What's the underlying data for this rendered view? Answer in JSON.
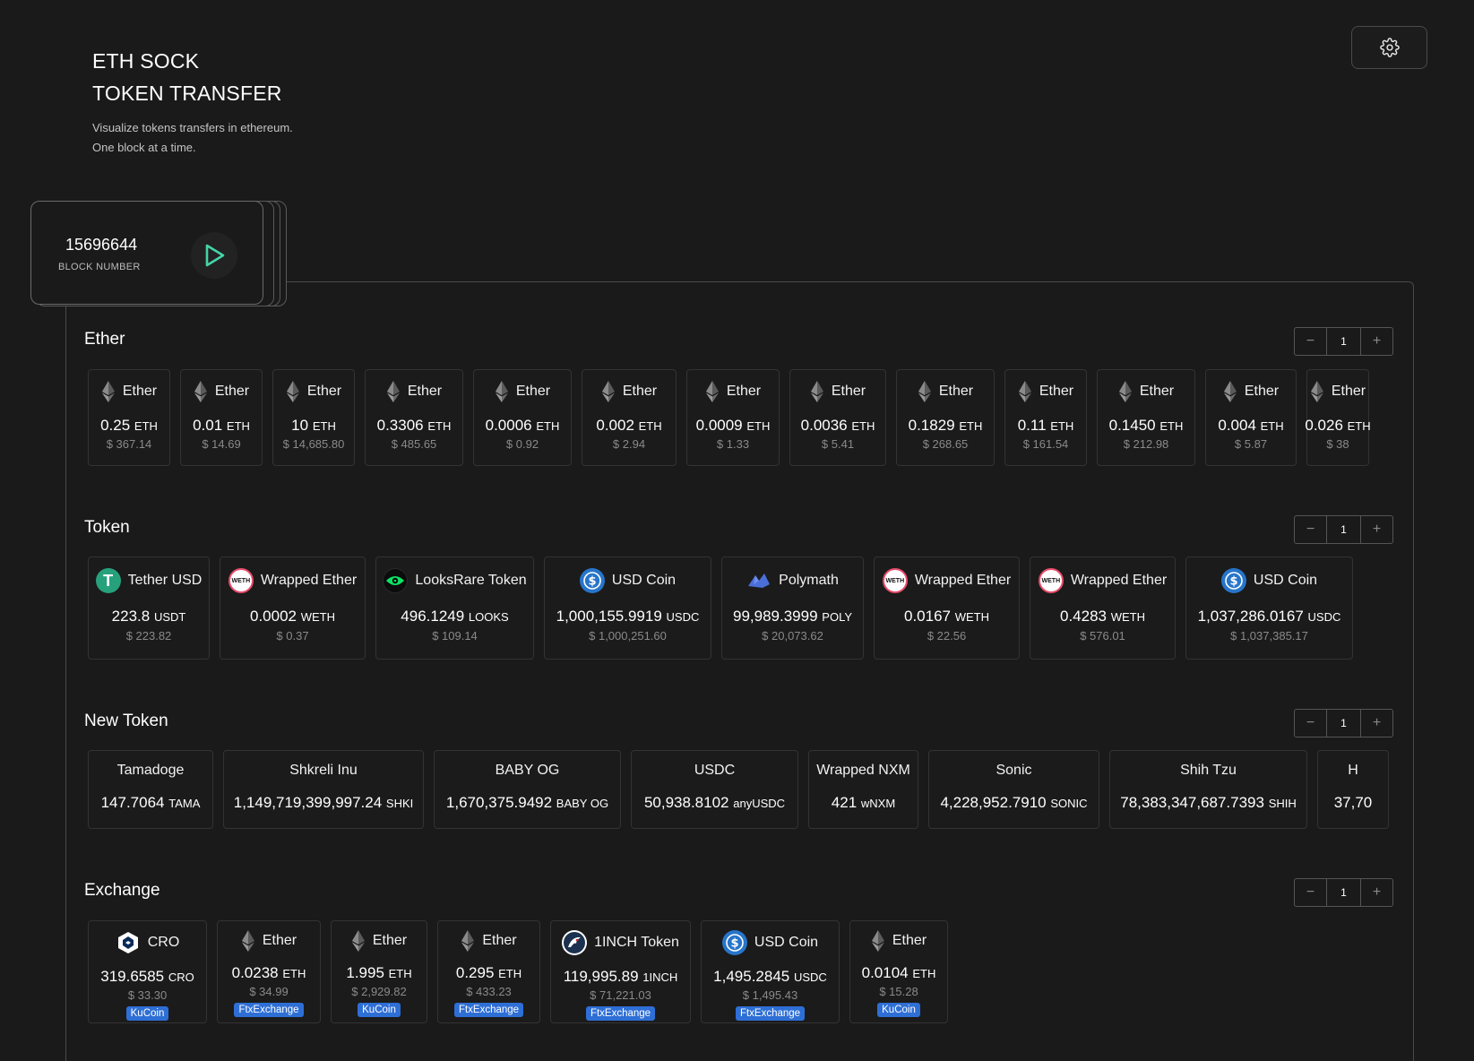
{
  "header": {
    "title_line1": "ETH SOCK",
    "title_line2": "TOKEN TRANSFER",
    "subtitle_line1": "Visualize tokens transfers in ethereum.",
    "subtitle_line2": "One block at a time."
  },
  "block": {
    "number": "15696644",
    "label": "BLOCK NUMBER"
  },
  "colors": {
    "accent": "#46d4a8",
    "badge": "#2e6fd6",
    "background": "#1a1a1a"
  },
  "sections": {
    "ether": {
      "title": "Ether",
      "stepper": {
        "minus": "−",
        "value": "1",
        "plus": "+"
      },
      "cards": [
        {
          "name": "Ether",
          "amount": "0.25",
          "symbol": "ETH",
          "usd": "$ 367.14"
        },
        {
          "name": "Ether",
          "amount": "0.01",
          "symbol": "ETH",
          "usd": "$ 14.69"
        },
        {
          "name": "Ether",
          "amount": "10",
          "symbol": "ETH",
          "usd": "$ 14,685.80"
        },
        {
          "name": "Ether",
          "amount": "0.3306",
          "symbol": "ETH",
          "usd": "$ 485.65"
        },
        {
          "name": "Ether",
          "amount": "0.0006",
          "symbol": "ETH",
          "usd": "$ 0.92"
        },
        {
          "name": "Ether",
          "amount": "0.002",
          "symbol": "ETH",
          "usd": "$ 2.94"
        },
        {
          "name": "Ether",
          "amount": "0.0009",
          "symbol": "ETH",
          "usd": "$ 1.33"
        },
        {
          "name": "Ether",
          "amount": "0.0036",
          "symbol": "ETH",
          "usd": "$ 5.41"
        },
        {
          "name": "Ether",
          "amount": "0.1829",
          "symbol": "ETH",
          "usd": "$ 268.65"
        },
        {
          "name": "Ether",
          "amount": "0.11",
          "symbol": "ETH",
          "usd": "$ 161.54"
        },
        {
          "name": "Ether",
          "amount": "0.1450",
          "symbol": "ETH",
          "usd": "$ 212.98"
        },
        {
          "name": "Ether",
          "amount": "0.004",
          "symbol": "ETH",
          "usd": "$ 5.87"
        },
        {
          "name": "Ether",
          "amount": "0.026",
          "symbol": "ETH",
          "usd": "$ 38"
        }
      ]
    },
    "token": {
      "title": "Token",
      "stepper": {
        "minus": "−",
        "value": "1",
        "plus": "+"
      },
      "cards": [
        {
          "icon": "tether-icon",
          "name": "Tether USD",
          "amount": "223.8",
          "symbol": "USDT",
          "usd": "$ 223.82"
        },
        {
          "icon": "weth-icon",
          "name": "Wrapped Ether",
          "amount": "0.0002",
          "symbol": "WETH",
          "usd": "$ 0.37"
        },
        {
          "icon": "looksrare-icon",
          "name": "LooksRare Token",
          "amount": "496.1249",
          "symbol": "LOOKS",
          "usd": "$ 109.14"
        },
        {
          "icon": "usdc-icon",
          "name": "USD Coin",
          "amount": "1,000,155.9919",
          "symbol": "USDC",
          "usd": "$ 1,000,251.60"
        },
        {
          "icon": "polymath-icon",
          "name": "Polymath",
          "amount": "99,989.3999",
          "symbol": "POLY",
          "usd": "$ 20,073.62"
        },
        {
          "icon": "weth-icon",
          "name": "Wrapped Ether",
          "amount": "0.0167",
          "symbol": "WETH",
          "usd": "$ 22.56"
        },
        {
          "icon": "weth-icon",
          "name": "Wrapped Ether",
          "amount": "0.4283",
          "symbol": "WETH",
          "usd": "$ 576.01"
        },
        {
          "icon": "usdc-icon",
          "name": "USD Coin",
          "amount": "1,037,286.0167",
          "symbol": "USDC",
          "usd": "$ 1,037,385.17"
        }
      ]
    },
    "new_token": {
      "title": "New Token",
      "stepper": {
        "minus": "−",
        "value": "1",
        "plus": "+"
      },
      "cards": [
        {
          "name": "Tamadoge",
          "amount": "147.7064",
          "symbol": "TAMA"
        },
        {
          "name": "Shkreli Inu",
          "amount": "1,149,719,399,997.24",
          "symbol": "SHKI"
        },
        {
          "name": "BABY OG",
          "amount": "1,670,375.9492",
          "symbol": "BABY OG"
        },
        {
          "name": "USDC",
          "amount": "50,938.8102",
          "symbol": "anyUSDC"
        },
        {
          "name": "Wrapped NXM",
          "amount": "421",
          "symbol": "wNXM"
        },
        {
          "name": "Sonic",
          "amount": "4,228,952.7910",
          "symbol": "SONIC"
        },
        {
          "name": "Shih Tzu",
          "amount": "78,383,347,687.7393",
          "symbol": "SHIH"
        },
        {
          "name": "H",
          "amount": "37,70",
          "symbol": ""
        }
      ]
    },
    "exchange": {
      "title": "Exchange",
      "stepper": {
        "minus": "−",
        "value": "1",
        "plus": "+"
      },
      "cards": [
        {
          "icon": "cro-icon",
          "name": "CRO",
          "amount": "319.6585",
          "symbol": "CRO",
          "usd": "$ 33.30",
          "exchange": "KuCoin"
        },
        {
          "icon": "ether-icon",
          "name": "Ether",
          "amount": "0.0238",
          "symbol": "ETH",
          "usd": "$ 34.99",
          "exchange": "FtxExchange"
        },
        {
          "icon": "ether-icon",
          "name": "Ether",
          "amount": "1.995",
          "symbol": "ETH",
          "usd": "$ 2,929.82",
          "exchange": "KuCoin"
        },
        {
          "icon": "ether-icon",
          "name": "Ether",
          "amount": "0.295",
          "symbol": "ETH",
          "usd": "$ 433.23",
          "exchange": "FtxExchange"
        },
        {
          "icon": "1inch-icon",
          "name": "1INCH Token",
          "amount": "119,995.89",
          "symbol": "1INCH",
          "usd": "$ 71,221.03",
          "exchange": "FtxExchange"
        },
        {
          "icon": "usdc-icon",
          "name": "USD Coin",
          "amount": "1,495.2845",
          "symbol": "USDC",
          "usd": "$ 1,495.43",
          "exchange": "FtxExchange"
        },
        {
          "icon": "ether-icon",
          "name": "Ether",
          "amount": "0.0104",
          "symbol": "ETH",
          "usd": "$ 15.28",
          "exchange": "KuCoin"
        }
      ]
    }
  }
}
